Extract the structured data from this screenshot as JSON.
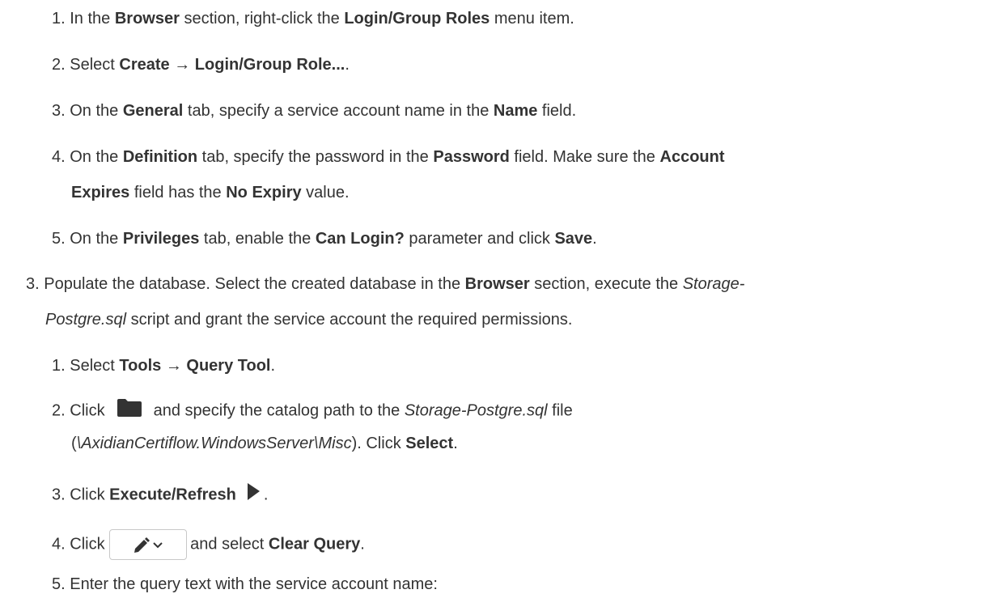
{
  "steps": {
    "s2_1": {
      "num": "1. ",
      "t1": "In the ",
      "b1": "Browser",
      "t2": " section, right-click the ",
      "b2": "Login/Group Roles",
      "t3": " menu item."
    },
    "s2_2": {
      "num": "2. ",
      "t1": "Select ",
      "b1": "Create",
      "t2": " → ",
      "b2": "Login/Group Role...",
      "t3": "."
    },
    "s2_3": {
      "num": "3. ",
      "t1": "On the ",
      "b1": "General",
      "t2": " tab, specify a service account name in the ",
      "b2": "Name",
      "t3": " field."
    },
    "s2_4": {
      "num": "4. ",
      "t1": "On the ",
      "b1": "Definition",
      "t2": " tab, specify the password in the ",
      "b2": "Password",
      "t3": " field. Make sure the ",
      "b3": "Account",
      "b4": "Expires",
      "t4": " field has the ",
      "b5": "No Expiry",
      "t5": " value."
    },
    "s2_5": {
      "num": "5. ",
      "t1": "On the ",
      "b1": "Privileges",
      "t2": " tab, enable the ",
      "b2": "Can Login?",
      "t3": " parameter and click ",
      "b3": "Save",
      "t4": "."
    },
    "s3": {
      "num": "3. ",
      "t1": "Populate the database. Select the created database in the ",
      "b1": "Browser",
      "t2": " section, execute the ",
      "i1": "Storage-",
      "i2": "Postgre.sql",
      "t3": " script and grant the service account the required permissions."
    },
    "s3_1": {
      "num": "1. ",
      "t1": "Select ",
      "b1": "Tools",
      "t2": " → ",
      "b2": "Query Tool",
      "t3": "."
    },
    "s3_2": {
      "num": "2. ",
      "t1": "Click",
      "t2": "and specify the catalog path to the ",
      "i1": "Storage-Postgre.sql",
      "t3": " file",
      "t4": "(",
      "i2": "\\AxidianCertiflow.WindowsServer\\Misc",
      "t5": "). Click ",
      "b1": "Select",
      "t6": "."
    },
    "s3_3": {
      "num": "3. ",
      "t1": "Click ",
      "b1": "Execute/Refresh",
      "t2": "."
    },
    "s3_4": {
      "num": "4. ",
      "t1": "Click ",
      "t2": "and select ",
      "b1": "Clear Query",
      "t3": "."
    },
    "s3_5": {
      "num": "5. ",
      "t1": "Enter the query text with the service account name:"
    }
  },
  "icons": {
    "folder": "folder-icon",
    "play": "play-icon",
    "edit": "pencil-dropdown-icon",
    "color": "#333333"
  }
}
